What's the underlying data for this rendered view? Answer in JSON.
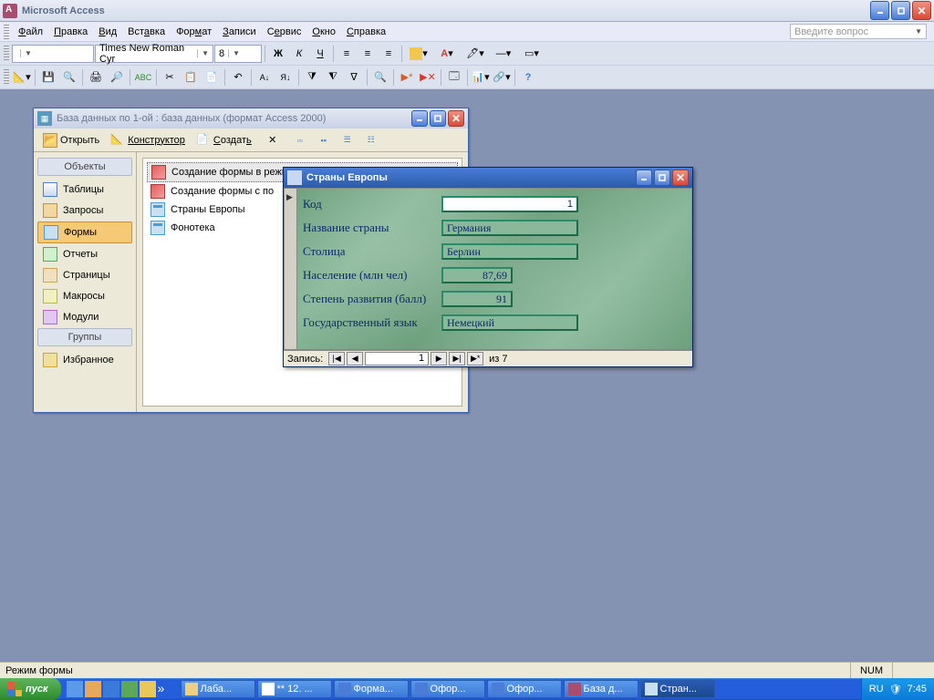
{
  "app": {
    "title": "Microsoft Access"
  },
  "menu": {
    "file": "Файл",
    "edit": "Правка",
    "view": "Вид",
    "insert": "Вставка",
    "format": "Формат",
    "records": "Записи",
    "service": "Сервис",
    "window": "Окно",
    "help": "Справка",
    "search_help": "Введите вопрос"
  },
  "format_tb": {
    "font": "Times New Roman Cyr",
    "size": "8"
  },
  "dbwin": {
    "title": "База данных по 1-ой : база данных (формат Access 2000)",
    "tb": {
      "open": "Открыть",
      "design": "Конструктор",
      "create": "Создать"
    },
    "groups": {
      "objects": "Объекты",
      "groups": "Группы"
    },
    "nav": {
      "tables": "Таблицы",
      "queries": "Запросы",
      "forms": "Формы",
      "reports": "Отчеты",
      "pages": "Страницы",
      "macros": "Макросы",
      "modules": "Модули",
      "favorites": "Избранное"
    },
    "list": {
      "i0": "Создание формы в режиме конструктора",
      "i1": "Создание формы с по",
      "i2": "Страны Европы",
      "i3": "Фонотека"
    }
  },
  "formwin": {
    "title": "Страны Европы",
    "labels": {
      "code": "Код",
      "country": "Название страны",
      "capital": "Столица",
      "population": "Население (млн чел)",
      "dev": "Степень развития (балл)",
      "lang": "Государственный язык"
    },
    "values": {
      "code": "1",
      "country": "Германия",
      "capital": "Берлин",
      "population": "87,69",
      "dev": "91",
      "lang": "Немецкий"
    },
    "recnav": {
      "label": "Запись:",
      "current": "1",
      "of": "из  7"
    }
  },
  "status": {
    "mode": "Режим формы",
    "num": "NUM"
  },
  "taskbar": {
    "start": "пуск",
    "tasks": {
      "t0": "Лаба...",
      "t1": "** 12. ...",
      "t2": "Форма...",
      "t3": "Офор...",
      "t4": "Офор...",
      "t5": "База д...",
      "t6": "Стран..."
    },
    "lang": "RU",
    "time": "7:45"
  }
}
